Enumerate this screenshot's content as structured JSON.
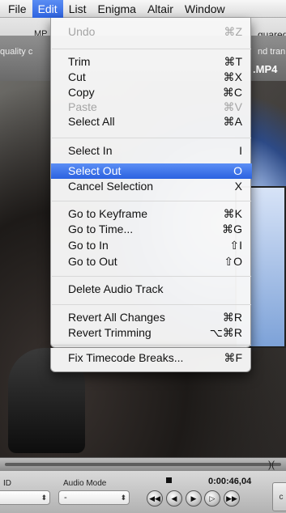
{
  "menubar": {
    "items": [
      {
        "label": "File",
        "active": false
      },
      {
        "label": "Edit",
        "active": true
      },
      {
        "label": "List",
        "active": false
      },
      {
        "label": "Enigma",
        "active": false
      },
      {
        "label": "Altair",
        "active": false
      },
      {
        "label": "Window",
        "active": false
      }
    ]
  },
  "background": {
    "toolbar_left": "MP",
    "toolbar_right": "quared",
    "title_left": "quality c",
    "title_right": "nd tran",
    "file_ext": ".MP4"
  },
  "edit_menu": {
    "items": [
      {
        "label": "Undo",
        "shortcut": "⌘Z",
        "disabled": true,
        "selected": false
      },
      {
        "label": "Trim",
        "shortcut": "⌘T",
        "disabled": false,
        "selected": false
      },
      {
        "label": "Cut",
        "shortcut": "⌘X",
        "disabled": false,
        "selected": false
      },
      {
        "label": "Copy",
        "shortcut": "⌘C",
        "disabled": false,
        "selected": false
      },
      {
        "label": "Paste",
        "shortcut": "⌘V",
        "disabled": true,
        "selected": false
      },
      {
        "label": "Select All",
        "shortcut": "⌘A",
        "disabled": false,
        "selected": false
      },
      {
        "label": "Select In",
        "shortcut": "I",
        "disabled": false,
        "selected": false
      },
      {
        "label": "Select Out",
        "shortcut": "O",
        "disabled": false,
        "selected": true
      },
      {
        "label": "Cancel Selection",
        "shortcut": "X",
        "disabled": false,
        "selected": false
      },
      {
        "label": "Go to Keyframe",
        "shortcut": "⌘K",
        "disabled": false,
        "selected": false
      },
      {
        "label": "Go to Time...",
        "shortcut": "⌘G",
        "disabled": false,
        "selected": false
      },
      {
        "label": "Go to In",
        "shortcut": "⇧I",
        "disabled": false,
        "selected": false
      },
      {
        "label": "Go to Out",
        "shortcut": "⇧O",
        "disabled": false,
        "selected": false
      },
      {
        "label": "Delete Audio Track",
        "shortcut": "",
        "disabled": false,
        "selected": false
      },
      {
        "label": "Revert All Changes",
        "shortcut": "⌘R",
        "disabled": false,
        "selected": false
      },
      {
        "label": "Revert Trimming",
        "shortcut": "⌥⌘R",
        "disabled": false,
        "selected": false
      },
      {
        "label": "Fix Timecode Breaks...",
        "shortcut": "⌘F",
        "disabled": false,
        "selected": false
      }
    ]
  },
  "controls": {
    "id_label": "ID",
    "audio_mode_label": "Audio Mode",
    "audio_mode_value": "-",
    "timecode": "0:00:46,04",
    "right_edge": "c"
  },
  "icons": {
    "stop": "stop-icon",
    "step_back": "rewind-icon",
    "prev_frame": "previous-frame-icon",
    "play": "play-icon",
    "next_frame": "next-frame-icon",
    "fast_forward": "fast-forward-icon"
  },
  "colors": {
    "menu_highlight": "#2e63e0",
    "menu_background": "#f7f7f7",
    "disabled_text": "#a5a5a5"
  }
}
